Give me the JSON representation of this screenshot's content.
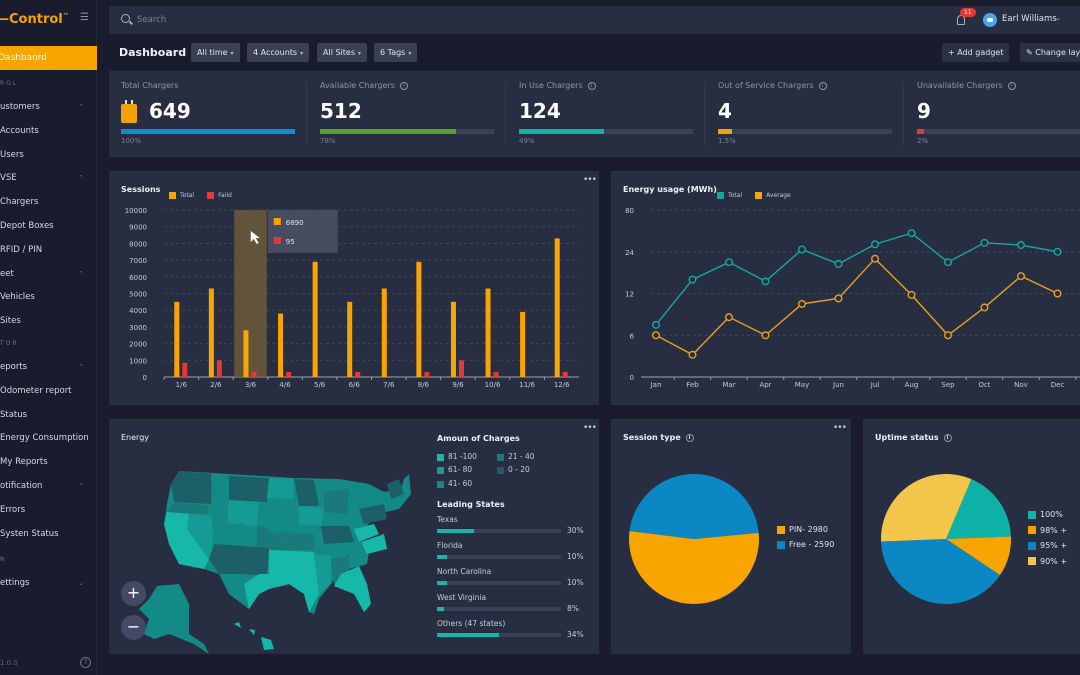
{
  "app": {
    "logo": "—Control",
    "version": "1.0.0"
  },
  "sidebar": {
    "active": "Dashbaord",
    "sections": [
      {
        "label": "ROL",
        "items": [
          {
            "label": "ustomers",
            "expandable": true
          },
          {
            "label": "Accounts"
          },
          {
            "label": "Users"
          },
          {
            "label": "VSE",
            "expandable": true
          },
          {
            "label": "Chargers"
          },
          {
            "label": "Depot Boxes"
          },
          {
            "label": "RFID / PIN"
          },
          {
            "label": "eet",
            "expandable": true
          },
          {
            "label": "Vehicles"
          },
          {
            "label": "Sites"
          }
        ]
      },
      {
        "label": "TOR",
        "items": [
          {
            "label": "eports",
            "expandable": true
          },
          {
            "label": "Odometer report"
          },
          {
            "label": "Status"
          },
          {
            "label": "Energy Consumption"
          },
          {
            "label": "My Reports"
          },
          {
            "label": "otification",
            "expandable": true
          },
          {
            "label": "Errors"
          },
          {
            "label": "Systen Status"
          }
        ]
      },
      {
        "label": "N",
        "items": [
          {
            "label": "ettings",
            "expandable": true,
            "collapsed": true
          }
        ]
      }
    ]
  },
  "topbar": {
    "search_placeholder": "Search",
    "notifications": "11",
    "user": "Earl Williams"
  },
  "header": {
    "title": "Dashboard",
    "filters": [
      "All time",
      "4 Accounts",
      "All Sites",
      "6 Tags"
    ],
    "add_gadget": "+ Add gadget",
    "change_layout": "Change lay"
  },
  "kpis": [
    {
      "label": "Total Chargers",
      "value": "649",
      "pct": "100%",
      "fill": 100,
      "color": "#0d8ed0",
      "info": false
    },
    {
      "label": "Available Chargers",
      "value": "512",
      "pct": "78%",
      "fill": 78,
      "color": "#5aa02c",
      "info": true
    },
    {
      "label": "In Use Chargers",
      "value": "124",
      "pct": "49%",
      "fill": 49,
      "color": "#12b3a6",
      "info": true
    },
    {
      "label": "Out of Service Chargers",
      "value": "4",
      "pct": "1.5%",
      "fill": 8,
      "color": "#f5a300",
      "info": true
    },
    {
      "label": "Unavailable Chargers",
      "value": "9",
      "pct": "2%",
      "fill": 4,
      "color": "#e53935",
      "info": true
    }
  ],
  "chart_data": [
    {
      "type": "bar",
      "title": "Sessions",
      "categories": [
        "1/6",
        "2/6",
        "3/6",
        "4/6",
        "5/6",
        "6/6",
        "7/6",
        "8/6",
        "9/6",
        "10/6",
        "11/6",
        "12/6"
      ],
      "series": [
        {
          "name": "Total",
          "color": "#f8a500",
          "values": [
            4500,
            5300,
            2800,
            3800,
            6900,
            4500,
            5300,
            6900,
            4500,
            5300,
            3900,
            8300
          ]
        },
        {
          "name": "Faild",
          "color": "#e53935",
          "values": [
            850,
            1000,
            300,
            300,
            0,
            300,
            0,
            300,
            1000,
            300,
            0,
            300
          ]
        }
      ],
      "yticks": [
        0,
        1000,
        2000,
        3000,
        4000,
        5000,
        6000,
        7000,
        8000,
        9000,
        10000
      ],
      "ylim": [
        0,
        10000
      ],
      "grid": true,
      "legend": "top-left",
      "tooltip": {
        "category": "3/6",
        "total": "6890",
        "failed": "95"
      }
    },
    {
      "type": "line",
      "title": "Energy usage (MWh)",
      "categories": [
        "Jan",
        "Feb",
        "Mar",
        "Apr",
        "May",
        "Jun",
        "Jul",
        "Aug",
        "Sep",
        "Oct",
        "Nov",
        "Dec"
      ],
      "yticks": [
        "0",
        "6",
        "12",
        "24",
        "80"
      ],
      "series": [
        {
          "name": "Total",
          "color": "#13a89e",
          "values": [
            7.5,
            16,
            21,
            15.5,
            27,
            20.5,
            34,
            49,
            21,
            36,
            33,
            24
          ]
        },
        {
          "name": "Average",
          "color": "#e8a11c",
          "values": [
            6,
            3.2,
            8.6,
            6,
            10.5,
            11.3,
            22,
            11.8,
            6,
            10,
            17,
            12
          ]
        }
      ],
      "grid": true,
      "legend": "top-left"
    },
    {
      "type": "pie",
      "title": "Session type",
      "slices": [
        {
          "label": "PIN- 2980",
          "value": 2980,
          "color": "#f8a500"
        },
        {
          "label": "Free - 2590",
          "value": 2590,
          "color": "#0b87c3"
        }
      ],
      "legend": "right"
    },
    {
      "type": "pie",
      "title": "Uptime status",
      "slices": [
        {
          "label": "100%",
          "value": 18,
          "color": "#0fb2a6"
        },
        {
          "label": "98% +",
          "value": 10,
          "color": "#f8a500"
        },
        {
          "label": "95% +",
          "value": 40,
          "color": "#0b87c3"
        },
        {
          "label": "90% +",
          "value": 32,
          "color": "#f2c64a"
        }
      ],
      "legend": "right"
    }
  ],
  "energy": {
    "title": "Energy",
    "amount_title": "Amoun of Charges",
    "amount_legend": [
      {
        "label": "81 -100",
        "color": "#16b8aa"
      },
      {
        "label": "21 - 40",
        "color": "#1a7a7a"
      },
      {
        "label": "61- 80",
        "color": "#139b94"
      },
      {
        "label": "0 - 20",
        "color": "#1c5f66"
      },
      {
        "label": "41- 60",
        "color": "#148a87"
      }
    ],
    "leading_title": "Leading States",
    "states": [
      {
        "name": "Texas",
        "pct": "30%",
        "fill": 30
      },
      {
        "name": "Florida",
        "pct": "10%",
        "fill": 8
      },
      {
        "name": "North Carolina",
        "pct": "10%",
        "fill": 8
      },
      {
        "name": "West Virginia",
        "pct": "8%",
        "fill": 6
      },
      {
        "name": "Others (47 states)",
        "pct": "34%",
        "fill": 50
      }
    ],
    "zoom_in": "+",
    "zoom_out": "−"
  },
  "session_type": {
    "title": "Session type"
  },
  "uptime": {
    "title": "Uptime status"
  }
}
